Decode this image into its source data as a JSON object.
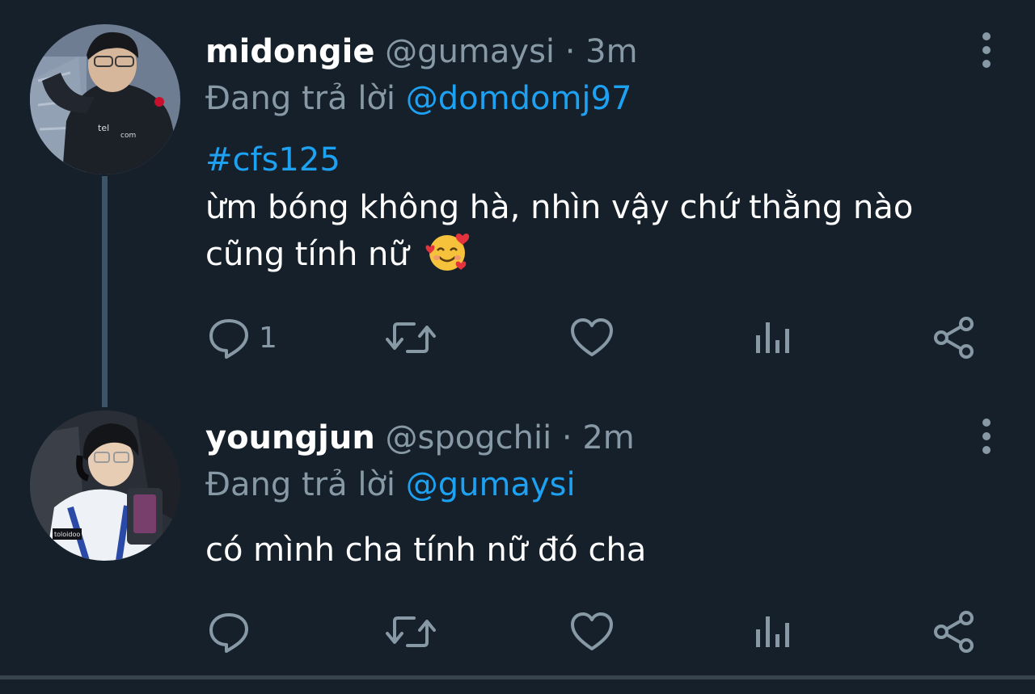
{
  "tweets": [
    {
      "name": "midongie",
      "handle": "@gumaysi",
      "separator": "·",
      "time": "3m",
      "reply_prefix": "Đang trả lời",
      "reply_to": "@domdomj97",
      "hashtag": "#cfs125",
      "text_line1": "ừm bóng không hà, nhìn vậy chứ thằng nào",
      "text_line2": "cũng tính nữ",
      "emoji": "smiling-face-with-hearts",
      "reply_count": "1"
    },
    {
      "name": "youngjun",
      "handle": "@spogchii",
      "separator": "·",
      "time": "2m",
      "reply_prefix": "Đang trả lời",
      "reply_to": "@gumaysi",
      "text_line1": "có mình cha tính nữ đó cha",
      "reply_count": ""
    }
  ],
  "colors": {
    "background": "#15202b",
    "primary_text": "#ffffff",
    "secondary_text": "#8899a6",
    "accent": "#1da1f2",
    "thread_line": "#3d5466"
  },
  "icons": {
    "reply": "reply-icon",
    "retweet": "retweet-icon",
    "like": "heart-icon",
    "stats": "analytics-icon",
    "share": "share-icon",
    "more": "more-vertical-icon"
  }
}
